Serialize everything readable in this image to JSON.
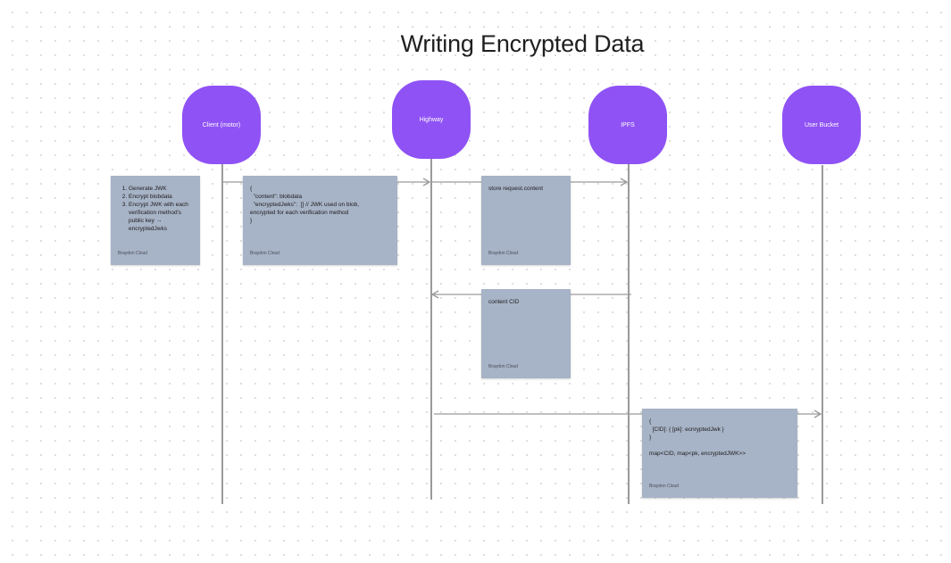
{
  "title": "Writing Encrypted Data",
  "actors": [
    {
      "id": "client",
      "label": "Client (motor)"
    },
    {
      "id": "highway",
      "label": "Highway"
    },
    {
      "id": "ipfs",
      "label": "IPFS"
    },
    {
      "id": "bucket",
      "label": "User Bucket"
    }
  ],
  "notes": {
    "client_steps": {
      "steps": [
        "Generate JWK",
        "Encrypt blobdata",
        "Encrypt JWK with each verification method's public key → encryptedJwks"
      ],
      "author": "Braydon Cloud"
    },
    "request_body": {
      "lines": [
        "{",
        "  \"content\": blobdata",
        "  \"encryptedJwks\":  [] // JWK used on blob,",
        "encrypted for each verification method",
        "}"
      ],
      "author": "Braydon Cloud"
    },
    "store": {
      "lines": [
        "store request.content"
      ],
      "author": "Braydon Cloud"
    },
    "cid": {
      "lines": [
        "content CID"
      ],
      "author": "Braydon Cloud"
    },
    "bucket_map": {
      "lines": [
        "{",
        "  [CID]: { [pk]: ecnryptedJwk }",
        "}",
        "",
        "map<CID, map<pk, encryptedJWK>>"
      ],
      "author": "Braydon Cloud"
    }
  }
}
